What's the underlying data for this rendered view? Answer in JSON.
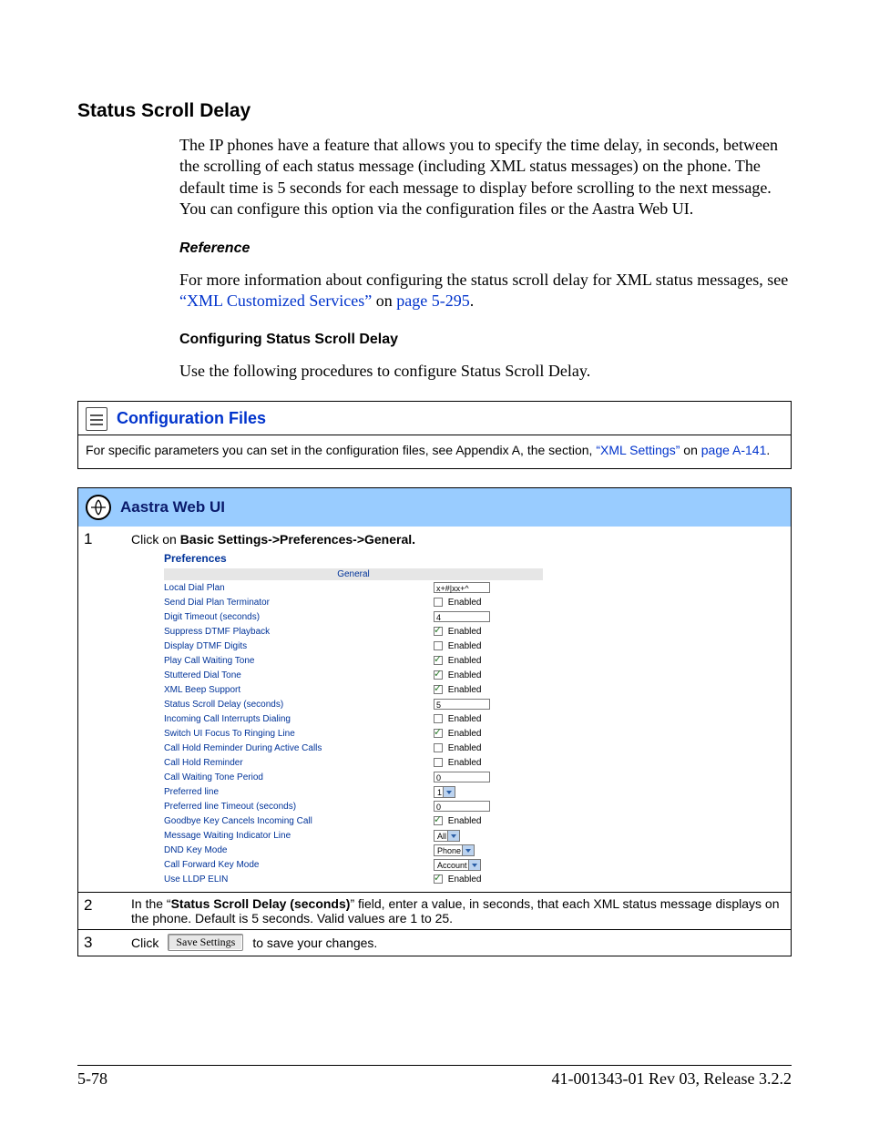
{
  "heading": "Status Scroll Delay",
  "intro": "The IP phones have a feature that allows you to specify the time delay, in seconds, between the scrolling of each status message (including XML status messages) on the phone. The default time is 5 seconds for each message to display before scrolling to the next message. You can configure this option via the configuration files or the Aastra Web UI.",
  "ref_h": "Reference",
  "ref_text_a": "For more information about configuring the status scroll delay for XML status messages, see ",
  "ref_link1": "“XML Customized Services”",
  "ref_on": " on ",
  "ref_link2": "page 5-295",
  "ref_dot": ".",
  "conf_h": "Configuring Status Scroll Delay",
  "conf_text": "Use the following procedures to configure Status Scroll Delay.",
  "box1_title": "Configuration Files",
  "box1_text_a": "For specific parameters you can set in the configuration files, see Appendix A, the section, ",
  "box1_link1": "“XML Settings”",
  "box1_on": " on ",
  "box1_link2": "page A-141",
  "box1_dot": ".",
  "box2_title": "Aastra Web UI",
  "step1_num": "1",
  "step1_a": "Click on ",
  "step1_b": "Basic Settings->Preferences->General.",
  "pref": "Preferences",
  "gen": "General",
  "settings": [
    {
      "label": "Local Dial Plan",
      "type": "text",
      "value": "x+#|xx+^"
    },
    {
      "label": "Send Dial Plan Terminator",
      "type": "check",
      "checked": false,
      "text": "Enabled"
    },
    {
      "label": "Digit Timeout (seconds)",
      "type": "text",
      "value": "4"
    },
    {
      "label": "Suppress DTMF Playback",
      "type": "check",
      "checked": true,
      "text": "Enabled"
    },
    {
      "label": "Display DTMF Digits",
      "type": "check",
      "checked": false,
      "text": "Enabled"
    },
    {
      "label": "Play Call Waiting Tone",
      "type": "check",
      "checked": true,
      "text": "Enabled"
    },
    {
      "label": "Stuttered Dial Tone",
      "type": "check",
      "checked": true,
      "text": "Enabled"
    },
    {
      "label": "XML Beep Support",
      "type": "check",
      "checked": true,
      "text": "Enabled"
    },
    {
      "label": "Status Scroll Delay (seconds)",
      "type": "text",
      "value": "5"
    },
    {
      "label": "Incoming Call Interrupts Dialing",
      "type": "check",
      "checked": false,
      "text": "Enabled"
    },
    {
      "label": "Switch UI Focus To Ringing Line",
      "type": "check",
      "checked": true,
      "text": "Enabled"
    },
    {
      "label": "Call Hold Reminder During Active Calls",
      "type": "check",
      "checked": false,
      "text": "Enabled"
    },
    {
      "label": "Call Hold Reminder",
      "type": "check",
      "checked": false,
      "text": "Enabled"
    },
    {
      "label": "Call Waiting Tone Period",
      "type": "text",
      "value": "0"
    },
    {
      "label": "Preferred line",
      "type": "select",
      "value": "1"
    },
    {
      "label": "Preferred line Timeout (seconds)",
      "type": "text",
      "value": "0"
    },
    {
      "label": "Goodbye Key Cancels Incoming Call",
      "type": "check",
      "checked": true,
      "text": "Enabled"
    },
    {
      "label": "Message Waiting Indicator Line",
      "type": "select",
      "value": "All"
    },
    {
      "label": "DND Key Mode",
      "type": "select",
      "value": "Phone"
    },
    {
      "label": "Call Forward Key Mode",
      "type": "select",
      "value": "Account"
    },
    {
      "label": "Use LLDP ELIN",
      "type": "check",
      "checked": true,
      "text": "Enabled"
    }
  ],
  "step2_num": "2",
  "step2_a": "In the “",
  "step2_b": "Status Scroll Delay (seconds)",
  "step2_c": "” field, enter a value, in seconds, that each XML status message displays on the phone. Default is 5 seconds. Valid values are 1 to 25.",
  "step3_num": "3",
  "step3_a": "Click",
  "save_btn": "Save Settings",
  "step3_b": "to save your changes.",
  "footer_left": "5-78",
  "footer_right": "41-001343-01 Rev 03, Release 3.2.2"
}
